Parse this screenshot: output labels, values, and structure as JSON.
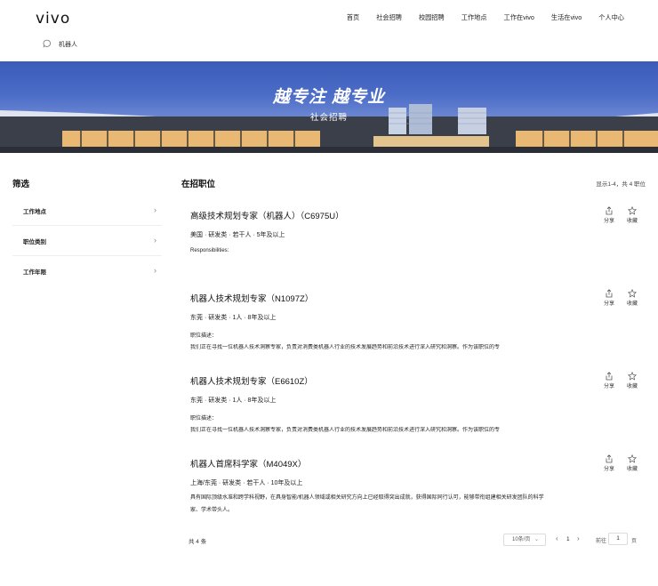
{
  "header": {
    "logo": "vivo",
    "nav": [
      "首页",
      "社会招聘",
      "校园招聘",
      "工作地点",
      "工作在vivo",
      "生活在vivo",
      "个人中心"
    ],
    "search": {
      "icon": "search-icon",
      "value": "机器人"
    }
  },
  "banner": {
    "title": "越专注  越专业",
    "subtitle": "社会招聘"
  },
  "filter": {
    "title": "筛选",
    "items": [
      "工作地点",
      "职位类别",
      "工作年限"
    ]
  },
  "list": {
    "title": "在招职位",
    "count": "显示1-4，共 4 职位",
    "jobs": [
      {
        "title": "高级技术规划专家（机器人）（C6975U）",
        "meta": "美国 · 研发类 · 若干人 · 5年及以上",
        "desc_label": "Responsibilities:",
        "desc": ""
      },
      {
        "title": "机器人技术规划专家（N1097Z）",
        "meta": "东莞 · 研发类 · 1人 · 8年及以上",
        "desc_label": "职位描述：",
        "desc": "我们正在寻找一位机器人技术洞察专家，负责对消费类机器人行业的技术发展趋势和前沿技术进行深入研究和洞察。作为该职位的专"
      },
      {
        "title": "机器人技术规划专家（E6610Z）",
        "meta": "东莞 · 研发类 · 1人 · 8年及以上",
        "desc_label": "职位描述：",
        "desc": "我们正在寻找一位机器人技术洞察专家，负责对消费类机器人行业的技术发展趋势和前沿技术进行深入研究和洞察。作为该职位的专"
      },
      {
        "title": "机器人首席科学家（M4049X）",
        "meta": "上海/东莞 · 研发类 · 若干人 · 10年及以上",
        "desc_label": "",
        "desc": "具有国际顶级水准和跨学科视野，在具身智能/机器人领域或相关研究方向上已经取得突出成就，获得国际同行认可，能够带衔组建相关研发团队的科学家、学术带头人。"
      }
    ],
    "actions": {
      "share": "分享",
      "collect": "收藏"
    }
  },
  "pagination": {
    "total": "共 4 条",
    "page_size": "10条/页",
    "current": "1",
    "goto_label": "前往",
    "goto_value": "1",
    "goto_unit": "页"
  }
}
